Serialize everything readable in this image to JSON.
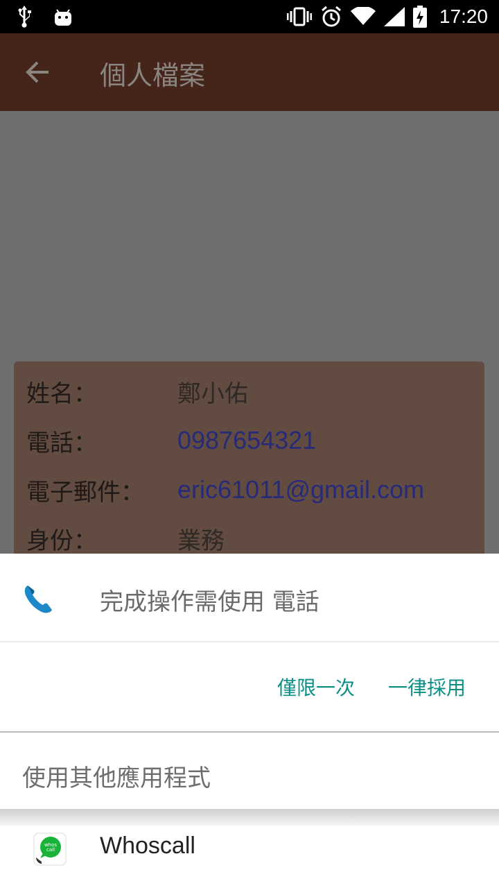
{
  "status_bar": {
    "time": "17:20",
    "icons": [
      "usb-icon",
      "android-icon",
      "vibrate-icon",
      "alarm-icon",
      "wifi-icon",
      "signal-icon",
      "battery-charging-icon"
    ]
  },
  "app_bar": {
    "back_icon": "arrow-back-icon",
    "title": "個人檔案"
  },
  "profile": {
    "rows": [
      {
        "label": "姓名：",
        "value": "鄭小佑"
      },
      {
        "label": "電話：",
        "value": "0987654321"
      },
      {
        "label": "電子郵件：",
        "value": "eric61011@gmail.com"
      },
      {
        "label": "身份：",
        "value": "業務"
      }
    ]
  },
  "sheet": {
    "title": "完成操作需使用 電話",
    "icon": "phone-icon",
    "once_label": "僅限一次",
    "always_label": "一律採用",
    "other_apps_label": "使用其他應用程式",
    "apps": [
      {
        "name": "Whoscall",
        "icon": "whoscall-icon",
        "icon_text": "whos call"
      }
    ]
  },
  "colors": {
    "app_bar": "#45241a",
    "card": "#624c41",
    "accent": "#0c8f86",
    "link": "#262a78"
  }
}
